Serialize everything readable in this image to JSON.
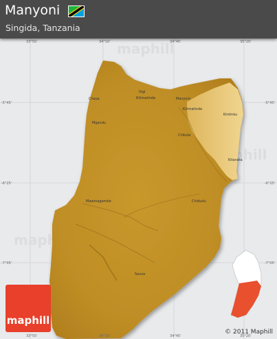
{
  "header": {
    "title": "Manyoni",
    "subtitle": "Singida, Tanzania"
  },
  "flag": {
    "country": "Tanzania",
    "colors": [
      "#1eb53a",
      "#fcd116",
      "#000000",
      "#00a3dd"
    ]
  },
  "map": {
    "background_color": "#e9eaec",
    "terrain_colors": [
      "#c99a2e",
      "#b8871f",
      "#e8c978"
    ],
    "places": [
      {
        "name": "Itigi",
        "value": "Itigi"
      },
      {
        "name": "Kilimatinde",
        "value": "Kilimatinde"
      },
      {
        "name": "Manyoni",
        "value": "Manyoni"
      },
      {
        "name": "Chaya",
        "value": "Chaya"
      },
      {
        "name": "Mgandu",
        "value": "Mgandu"
      },
      {
        "name": "Kintinku",
        "value": "Kintinku"
      },
      {
        "name": "Chikola",
        "value": "Chikola"
      },
      {
        "name": "Kilimatinde2",
        "value": "Kilimatinde"
      },
      {
        "name": "Kitaraka",
        "value": "Kitaraka"
      },
      {
        "name": "Mwamagembe",
        "value": "Mwamagembe"
      },
      {
        "name": "Chidudu",
        "value": "Chidudu"
      },
      {
        "name": "Sanza",
        "value": "Sanza"
      }
    ],
    "top_ticks": [
      "33°55'",
      "34°10'",
      "34°45'",
      "35°20'"
    ],
    "bottom_ticks": [
      "33°55'",
      "34°10'",
      "34°45'",
      "35°20'"
    ],
    "left_ticks": [
      "-5°45'",
      "-6°25'",
      "-7°05'"
    ],
    "right_ticks": [
      "-5°45'",
      "-6°25'",
      "-7°05'"
    ],
    "watermark": "maphill"
  },
  "logo": {
    "text": "maphill",
    "color": "#e8402a"
  },
  "copyright": "© 2011 Maphill",
  "locator": {
    "highlight_color": "#e8502e",
    "region_color": "#ffffff"
  }
}
